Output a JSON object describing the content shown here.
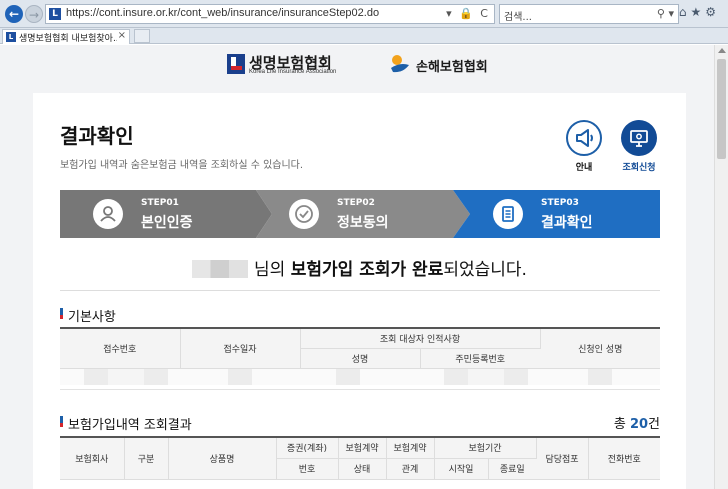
{
  "browser": {
    "url": "https://cont.insure.or.kr/cont_web/insurance/insuranceStep02.do",
    "search_placeholder": "검색...",
    "tab_title": "생명보험협회 내보험찾아..."
  },
  "logos": {
    "life_name": "생명보험협회",
    "life_sub": "Korea Life Insurance Association",
    "nonlife_name": "손해보험협회"
  },
  "header": {
    "title": "결과확인",
    "description": "보험가입 내역과 숨은보험금 내역을 조회하실 수 있습니다.",
    "guide_label": "안내",
    "request_label": "조회신청"
  },
  "steps": [
    {
      "num": "STEP01",
      "name": "본인인증",
      "color": "#777777"
    },
    {
      "num": "STEP02",
      "name": "정보동의",
      "color": "#888888"
    },
    {
      "num": "STEP03",
      "name": "결과확인",
      "color": "#1f6ec2"
    }
  ],
  "completion": {
    "suffix_1": "님의 ",
    "bold": "보험가입 조회가 완료",
    "suffix_2": "되었습니다."
  },
  "basic_section": {
    "title": "기본사항",
    "headers": {
      "receipt_no": "접수번호",
      "receipt_date": "접수일자",
      "target_group": "조회 대상자 인적사항",
      "name": "성명",
      "resident_no": "주민등록번호",
      "applicant_name": "신청인 성명"
    }
  },
  "result_section": {
    "title": "보험가입내역 조회결과",
    "count_prefix": "총 ",
    "count": "20",
    "count_suffix": "건",
    "headers": {
      "company": "보험회사",
      "category": "구분",
      "product": "상품명",
      "policy_no_1": "증권(계좌)",
      "policy_no_2": "번호",
      "status_1": "보험계약",
      "status_2": "상태",
      "relation_1": "보험계약",
      "relation_2": "관계",
      "period": "보험기간",
      "start": "시작일",
      "end": "종료일",
      "branch": "담당점포",
      "phone": "전화번호"
    }
  }
}
